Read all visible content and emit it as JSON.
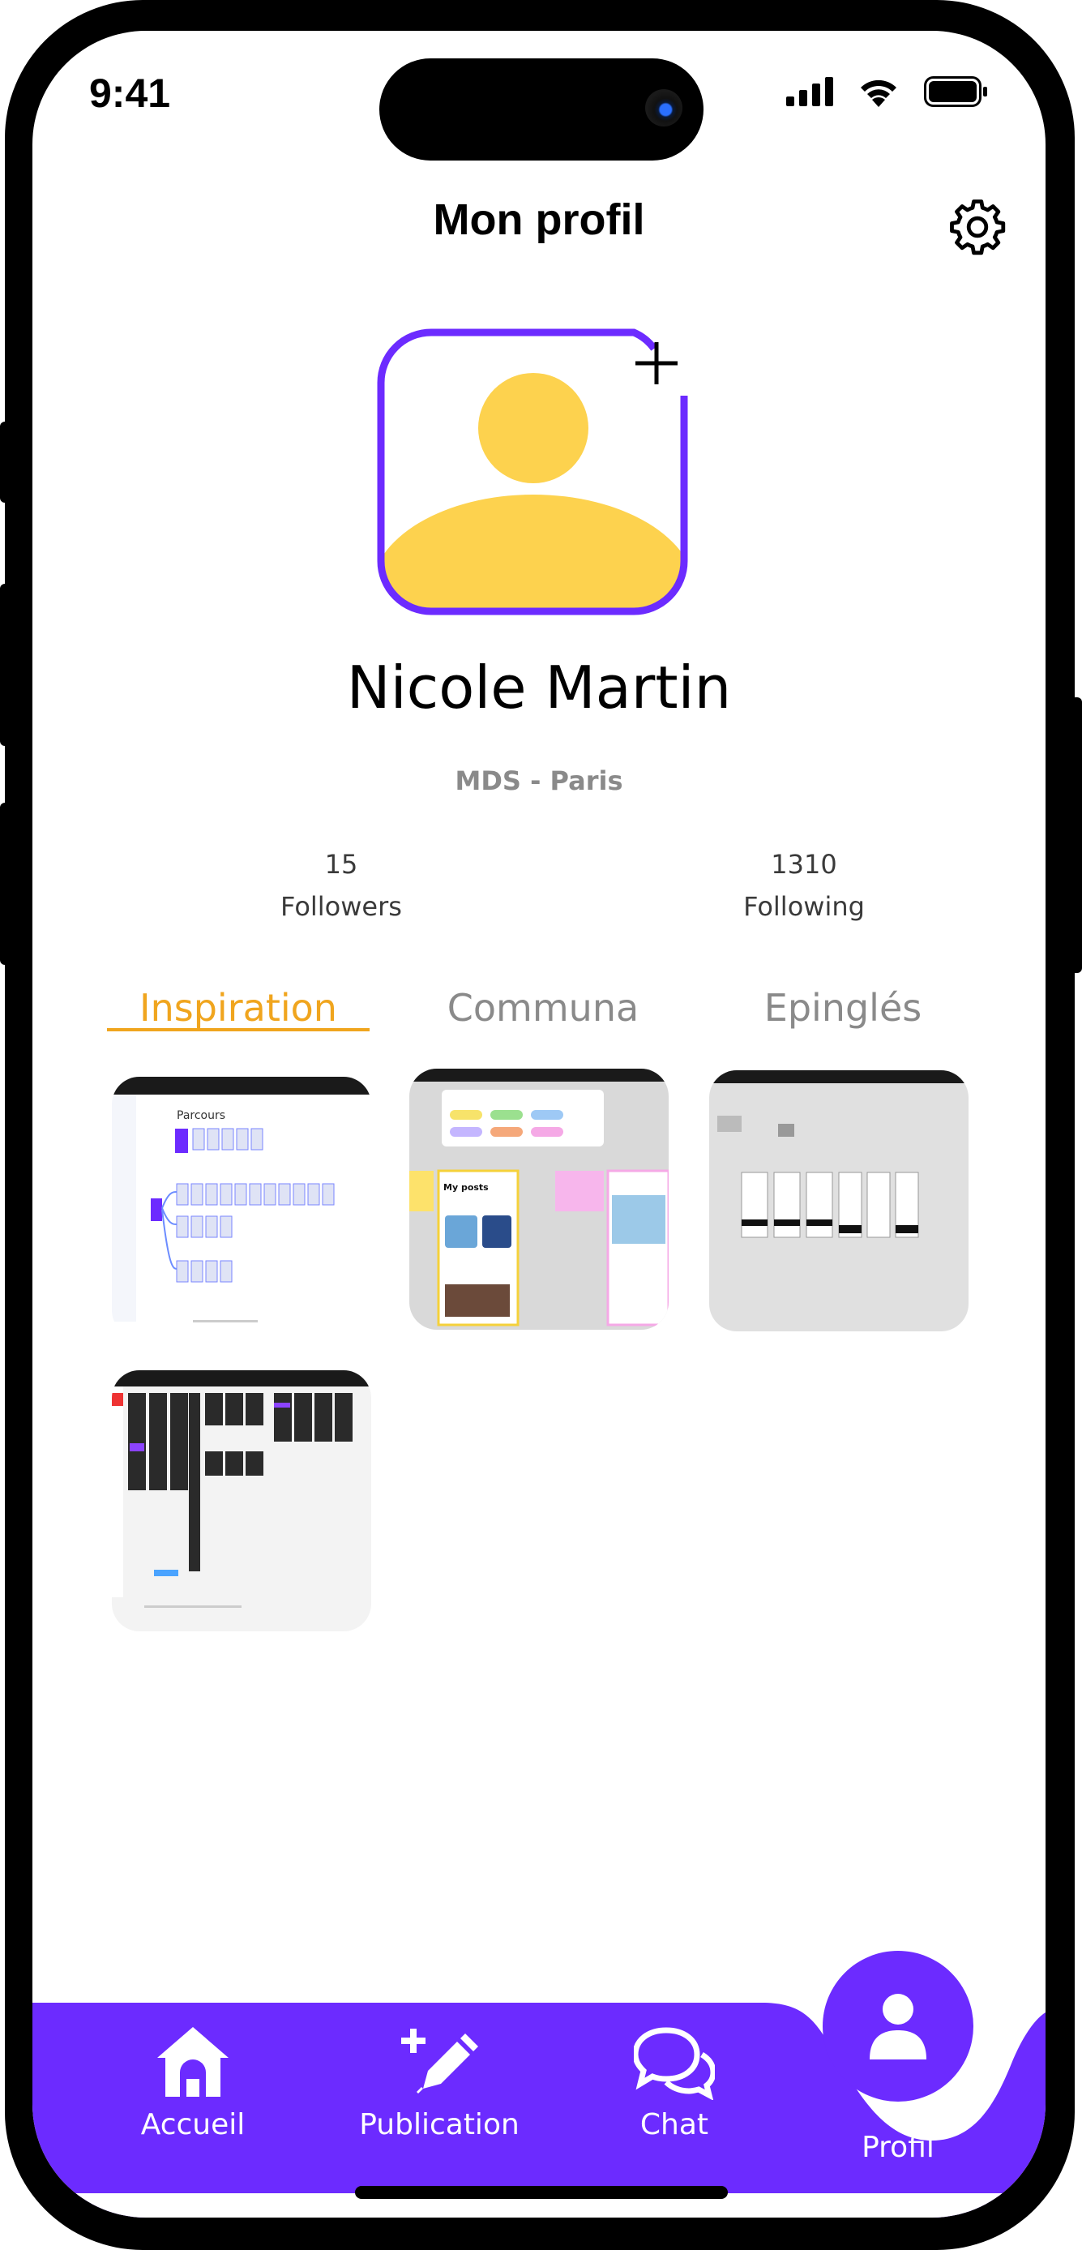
{
  "status_bar": {
    "time": "9:41"
  },
  "header": {
    "title": "Mon profil"
  },
  "profile": {
    "name": "Nicole Martin",
    "school": "MDS - Paris",
    "followers_count": "15",
    "followers_label": "Followers",
    "following_count": "1310",
    "following_label": "Following"
  },
  "tabs": [
    {
      "label": "Inspiration",
      "active": true
    },
    {
      "label": "Communa",
      "active": false
    },
    {
      "label": "Epinglés",
      "active": false
    }
  ],
  "thumbnails": [
    {
      "title": "Parcours"
    },
    {
      "title": "My posts"
    },
    {
      "title": ""
    },
    {
      "title": ""
    }
  ],
  "bottom_nav": [
    {
      "label": "Accueil",
      "icon": "home-icon"
    },
    {
      "label": "Publication",
      "icon": "pen-plus-icon"
    },
    {
      "label": "Chat",
      "icon": "chat-icon"
    },
    {
      "label": "Profil",
      "icon": "user-icon",
      "active": true
    }
  ],
  "colors": {
    "accent": "#6c2bff",
    "avatar_yellow": "#fdd24e",
    "active_tab": "#f0a51e"
  }
}
